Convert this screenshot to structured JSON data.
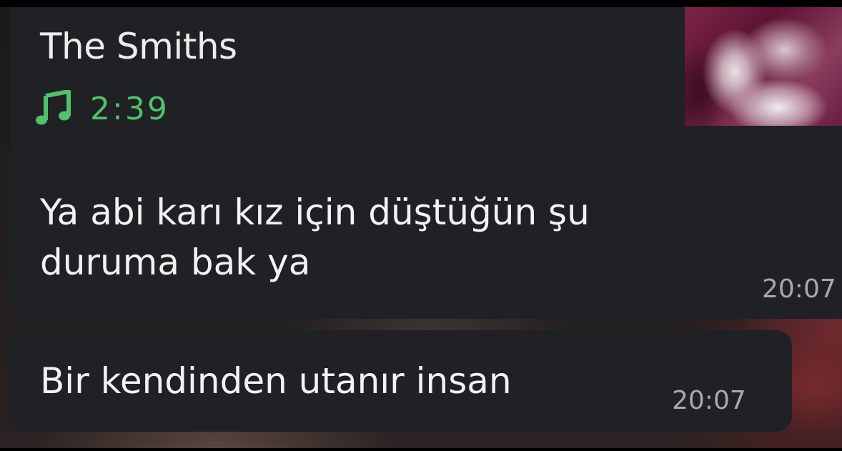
{
  "music_message": {
    "artist": "The Smiths",
    "duration": "2:39",
    "note_icon": "music-note-icon",
    "accent_color": "#4fc26a"
  },
  "messages": [
    {
      "lines": [
        "Ya abi karı kız için düştüğün şu",
        "duruma bak ya"
      ],
      "time": "20:07"
    },
    {
      "lines": [
        "Bir kendinden utanır insan"
      ],
      "time": "20:07"
    }
  ],
  "colors": {
    "bubble": "#1f2124",
    "text": "#f2f2f2",
    "timestamp": "#a8a9aa"
  }
}
